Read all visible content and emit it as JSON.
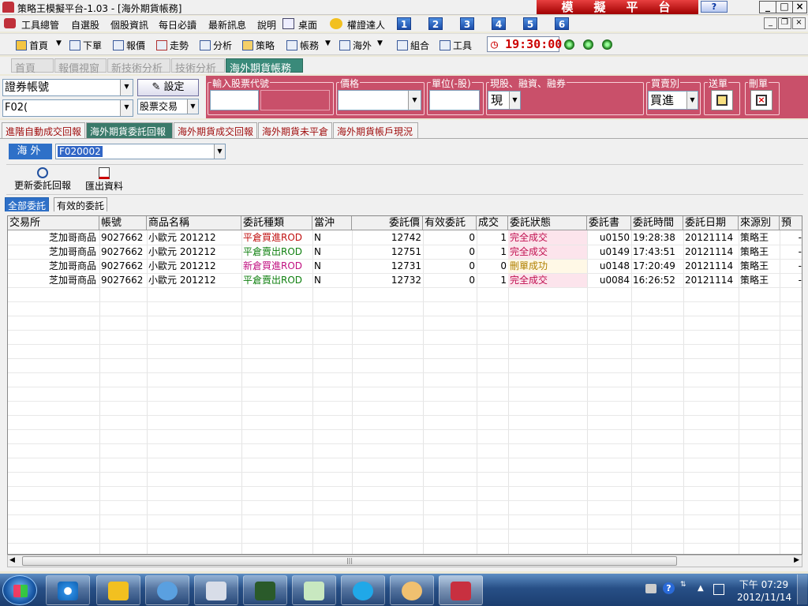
{
  "window": {
    "title": "策略王模擬平台-1.03 - [海外期貨帳務]",
    "banner": "模擬平台",
    "help": "?"
  },
  "menu": [
    "工具總管",
    "自選股",
    "個股資訊",
    "每日必讀",
    "最新訊息",
    "說明",
    "桌面",
    "權證達人"
  ],
  "quick_numbers": [
    "1",
    "2",
    "3",
    "4",
    "5",
    "6"
  ],
  "toolbar": {
    "items": [
      "首頁",
      "下單",
      "報價",
      "走勢",
      "分析",
      "策略",
      "帳務",
      "海外",
      "組合",
      "工具"
    ],
    "clock": "19:30:00"
  },
  "top_tabs": [
    "首頁",
    "報價視窗",
    "新技術分析",
    "技術分析",
    "海外期貨帳務"
  ],
  "order_entry": {
    "account_type": "證券帳號",
    "account_value": "F02(",
    "settings_button": "設定",
    "trade_type": "股票交易",
    "fields": {
      "stock_code": "輸入股票代號",
      "price": "價格",
      "unit": "單位(-股)",
      "cash_margin": "現股、融資、融券",
      "buy_sell": "買賣別",
      "send": "送單",
      "delete": "刪單"
    },
    "cash_value": "現",
    "side_value": "買進"
  },
  "report_tabs": [
    "進階自動成交回報",
    "海外期貨委託回報",
    "海外期貨成交回報",
    "海外期貨未平倉",
    "海外期貨帳戶現況"
  ],
  "account_bar": {
    "label": "海外",
    "account": "F020002"
  },
  "actions": {
    "refresh": "更新委託回報",
    "export": "匯出資料"
  },
  "filter_tabs": [
    "全部委託",
    "有效的委託"
  ],
  "table": {
    "columns": [
      "交易所",
      "帳號",
      "商品名稱",
      "委託種類",
      "當沖",
      "委託價",
      "有效委託",
      "成交",
      "委託狀態",
      "委託書",
      "委託時間",
      "委託日期",
      "來源別",
      "預"
    ],
    "rows": [
      [
        "芝加哥商品",
        "9027662",
        "小歐元 201212",
        "平倉買進ROD",
        "N",
        "12742",
        "0",
        "1",
        "完全成交",
        "u0150",
        "19:28:38",
        "20121114",
        "策略王",
        "-"
      ],
      [
        "芝加哥商品",
        "9027662",
        "小歐元 201212",
        "平倉賣出ROD",
        "N",
        "12751",
        "0",
        "1",
        "完全成交",
        "u0149",
        "17:43:51",
        "20121114",
        "策略王",
        "-"
      ],
      [
        "芝加哥商品",
        "9027662",
        "小歐元 201212",
        "新倉買進ROD",
        "N",
        "12731",
        "0",
        "0",
        "刪單成功",
        "u0148",
        "17:20:49",
        "20121114",
        "策略王",
        "-"
      ],
      [
        "芝加哥商品",
        "9027662",
        "小歐元 201212",
        "平倉賣出ROD",
        "N",
        "12732",
        "0",
        "1",
        "完全成交",
        "u0084",
        "16:26:52",
        "20121114",
        "策略王",
        "-"
      ]
    ],
    "status_colors": {
      "完全成交": "#fce4ec",
      "刪單成功": "#fff8e6"
    },
    "type_colors": {
      "buy": "#c01010",
      "sell": "#108010",
      "new": "#c01080"
    }
  },
  "taskbar": {
    "time": "下午 07:29",
    "date": "2012/11/14"
  }
}
